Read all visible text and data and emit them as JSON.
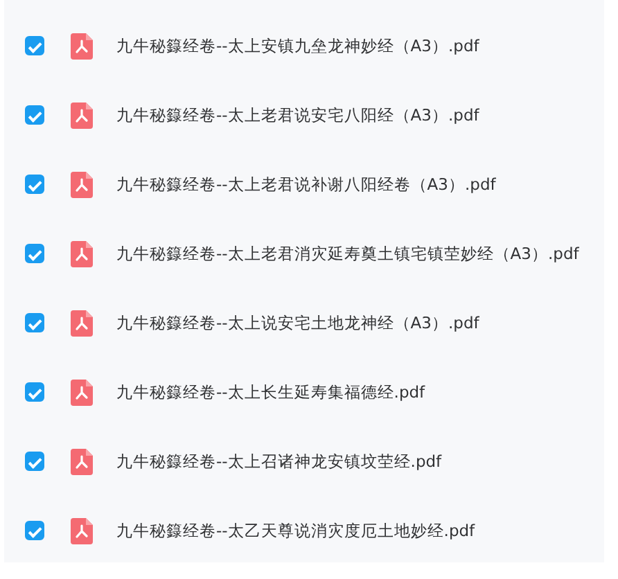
{
  "files": [
    {
      "name": "九牛秘籙经卷--太上安镇九垒龙神妙经（A3）.pdf",
      "checked": true
    },
    {
      "name": "九牛秘籙经卷--太上老君说安宅八阳经（A3）.pdf",
      "checked": true
    },
    {
      "name": "九牛秘籙经卷--太上老君说补谢八阳经卷（A3）.pdf",
      "checked": true
    },
    {
      "name": "九牛秘籙经卷--太上老君消灾延寿奠土镇宅镇茔妙经（A3）.pdf",
      "checked": true
    },
    {
      "name": "九牛秘籙经卷--太上说安宅土地龙神经（A3）.pdf",
      "checked": true
    },
    {
      "name": "九牛秘籙经卷--太上长生延寿集福德经.pdf",
      "checked": true
    },
    {
      "name": "九牛秘籙经卷--太上召诸神龙安镇坟茔经.pdf",
      "checked": true
    },
    {
      "name": "九牛秘籙经卷--太乙天尊说消灾度厄土地妙经.pdf",
      "checked": true
    }
  ]
}
